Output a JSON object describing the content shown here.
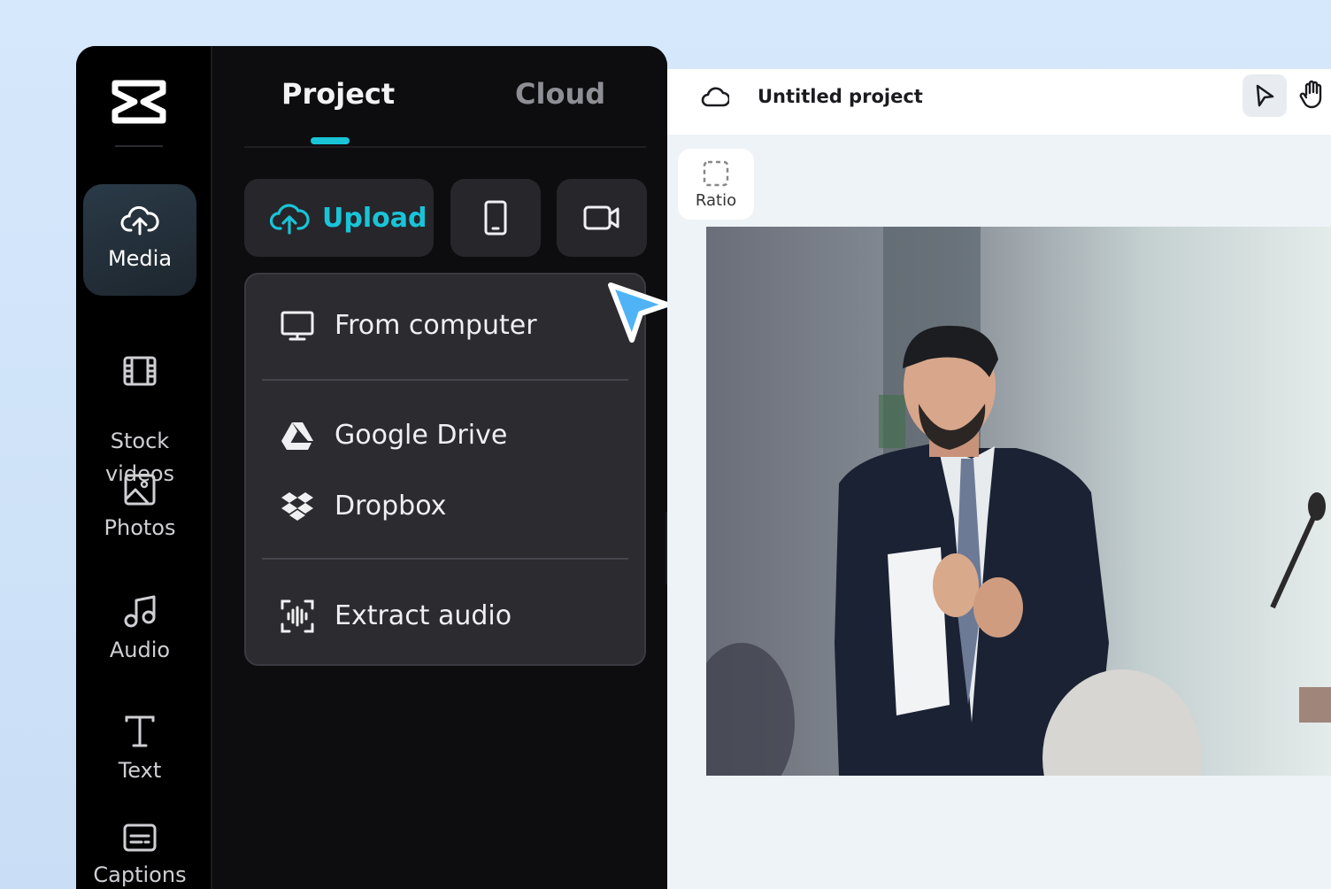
{
  "rail": {
    "items": [
      {
        "label": "Media",
        "icon": "cloud-upload-icon",
        "active": true
      },
      {
        "label": "Stock\nvideos",
        "icon": "film-icon"
      },
      {
        "label": "Photos",
        "icon": "image-icon"
      },
      {
        "label": "Audio",
        "icon": "music-note-icon"
      },
      {
        "label": "Text",
        "icon": "text-t-icon"
      },
      {
        "label": "Captions",
        "icon": "captions-icon"
      }
    ]
  },
  "panel": {
    "tabs": [
      {
        "label": "Project",
        "active": true
      },
      {
        "label": "Cloud"
      }
    ],
    "upload_label": "Upload",
    "dropdown": [
      {
        "label": "From computer",
        "icon": "monitor-icon"
      },
      {
        "label": "Google Drive",
        "icon": "google-drive-icon"
      },
      {
        "label": "Dropbox",
        "icon": "dropbox-icon"
      },
      {
        "label": "Extract audio",
        "icon": "extract-audio-icon"
      }
    ]
  },
  "editor": {
    "project_title": "Untitled project",
    "ratio_label": "Ratio"
  },
  "colors": {
    "accent": "#19c4d7",
    "cursor": "#4fb3f6"
  }
}
